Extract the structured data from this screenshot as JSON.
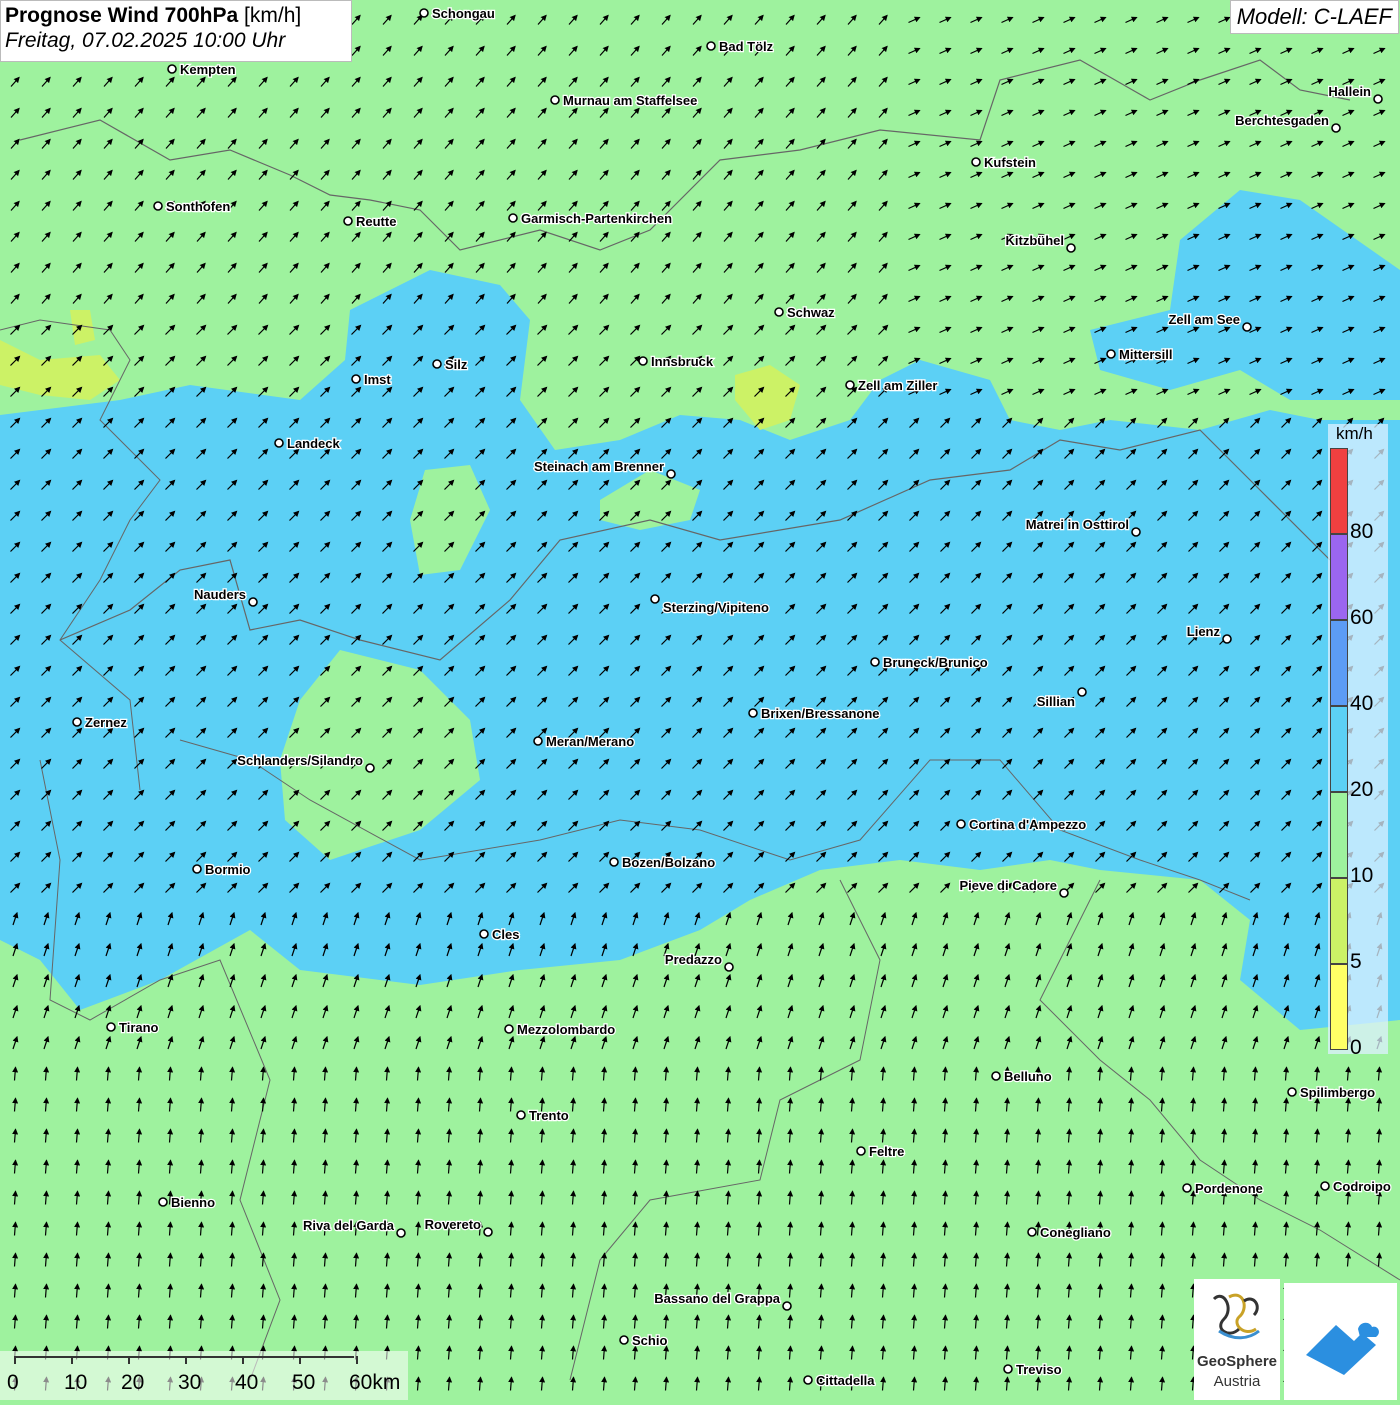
{
  "header": {
    "title_bold": "Prognose Wind 700hPa",
    "title_unit": "[km/h]",
    "datetime": "Freitag, 07.02.2025 10:00 Uhr",
    "model": "Modell: C-LAEF"
  },
  "legend": {
    "unit": "km/h",
    "bins": [
      {
        "label": "0",
        "color": "#ffff66"
      },
      {
        "label": "5",
        "color": "#ccf266"
      },
      {
        "label": "10",
        "color": "#9ef29e"
      },
      {
        "label": "20",
        "color": "#5cd0f5"
      },
      {
        "label": "40",
        "color": "#5c9cf5"
      },
      {
        "label": "60",
        "color": "#9b66f0"
      },
      {
        "label": "80",
        "color": "#f04040"
      }
    ]
  },
  "scale": {
    "labels": [
      "0",
      "10",
      "20",
      "30",
      "40",
      "50",
      "60km"
    ]
  },
  "logos": {
    "geosphere_line1": "GeoSphere",
    "geosphere_line2": "Austria"
  },
  "cities": [
    {
      "name": "Schongau"
    },
    {
      "name": "Bad Tölz"
    },
    {
      "name": "Kempten"
    },
    {
      "name": "Murnau am Staffelsee"
    },
    {
      "name": "Hallein"
    },
    {
      "name": "Berchtesgaden"
    },
    {
      "name": "Kufstein"
    },
    {
      "name": "Sonthofen"
    },
    {
      "name": "Reutte"
    },
    {
      "name": "Garmisch-Partenkirchen"
    },
    {
      "name": "Kitzbühel"
    },
    {
      "name": "Schwaz"
    },
    {
      "name": "Zell am See"
    },
    {
      "name": "Mittersill"
    },
    {
      "name": "Silz"
    },
    {
      "name": "Innsbruck"
    },
    {
      "name": "Imst"
    },
    {
      "name": "Zell am Ziller"
    },
    {
      "name": "Landeck"
    },
    {
      "name": "Steinach am Brenner"
    },
    {
      "name": "Matrei in Osttirol"
    },
    {
      "name": "Nauders"
    },
    {
      "name": "Sterzing/Vipiteno"
    },
    {
      "name": "Lienz"
    },
    {
      "name": "Bruneck/Brunico"
    },
    {
      "name": "Sillian"
    },
    {
      "name": "Zernez"
    },
    {
      "name": "Brixen/Bressanone"
    },
    {
      "name": "Meran/Merano"
    },
    {
      "name": "Schlanders/Silandro"
    },
    {
      "name": "Cortina d'Ampezzo"
    },
    {
      "name": "Bormio"
    },
    {
      "name": "Bozen/Bolzano"
    },
    {
      "name": "Pieve di Cadore"
    },
    {
      "name": "Cles"
    },
    {
      "name": "Predazzo"
    },
    {
      "name": "Tirano"
    },
    {
      "name": "Mezzolombardo"
    },
    {
      "name": "Belluno"
    },
    {
      "name": "Spilimbergo"
    },
    {
      "name": "Trento"
    },
    {
      "name": "Feltre"
    },
    {
      "name": "Pordenone"
    },
    {
      "name": "Codroipo"
    },
    {
      "name": "Bienno"
    },
    {
      "name": "Riva del Garda"
    },
    {
      "name": "Rovereto"
    },
    {
      "name": "Conegliano"
    },
    {
      "name": "Bassano del Grappa"
    },
    {
      "name": "Schio"
    },
    {
      "name": "Treviso"
    },
    {
      "name": "Cittadella"
    }
  ]
}
